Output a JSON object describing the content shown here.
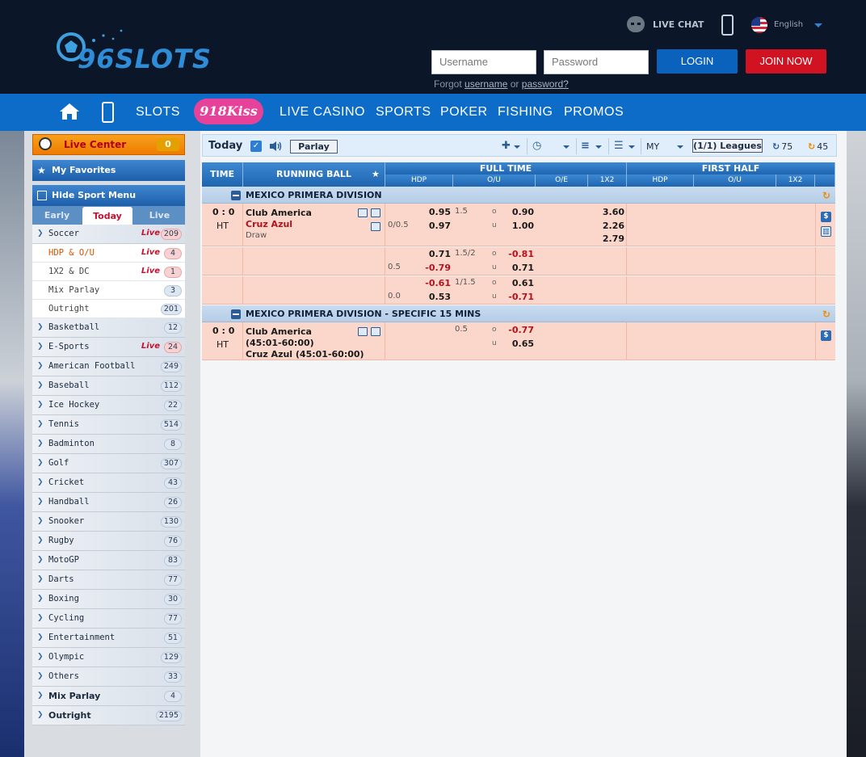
{
  "brand": {
    "logo_text": "96SLOTS"
  },
  "header": {
    "live_chat": "LIVE CHAT",
    "language": "English",
    "username_placeholder": "Username",
    "password_placeholder": "Password",
    "login": "LOGIN",
    "join": "JOIN NOW",
    "forgot_prefix": "Forgot",
    "forgot_username": "username",
    "forgot_or": "or",
    "forgot_password": "password?"
  },
  "nav": {
    "slots": "SLOTS",
    "kiss": "918Kiss",
    "live_casino": "LIVE CASINO",
    "sports": "SPORTS",
    "poker": "POKER",
    "fishing": "FISHING",
    "promos": "PROMOS"
  },
  "sidebar": {
    "live_center": "Live Center",
    "live_center_count": "0",
    "my_favorites": "My Favorites",
    "hide_menu": "Hide Sport Menu",
    "tabs": [
      "Early",
      "Today",
      "Live"
    ],
    "live_label": "Live",
    "sports": [
      {
        "name": "Soccer",
        "live": true,
        "count": "209"
      },
      {
        "name": "HDP & O/U",
        "live": true,
        "count": "4"
      },
      {
        "name": "1X2 & DC",
        "live": true,
        "count": "1"
      },
      {
        "name": "Mix Parlay",
        "count": "3"
      },
      {
        "name": "Outright",
        "count": "201"
      },
      {
        "name": "Basketball",
        "count": "12"
      },
      {
        "name": "E-Sports",
        "live": true,
        "count": "24"
      },
      {
        "name": "American Football",
        "count": "249"
      },
      {
        "name": "Baseball",
        "count": "112"
      },
      {
        "name": "Ice Hockey",
        "count": "22"
      },
      {
        "name": "Tennis",
        "count": "514"
      },
      {
        "name": "Badminton",
        "count": "8"
      },
      {
        "name": "Golf",
        "count": "307"
      },
      {
        "name": "Cricket",
        "count": "43"
      },
      {
        "name": "Handball",
        "count": "26"
      },
      {
        "name": "Snooker",
        "count": "130"
      },
      {
        "name": "Rugby",
        "count": "76"
      },
      {
        "name": "MotoGP",
        "count": "83"
      },
      {
        "name": "Darts",
        "count": "77"
      },
      {
        "name": "Boxing",
        "count": "30"
      },
      {
        "name": "Cycling",
        "count": "77"
      },
      {
        "name": "Entertainment",
        "count": "51"
      },
      {
        "name": "Olympic",
        "count": "129"
      },
      {
        "name": "Others",
        "count": "33"
      },
      {
        "name": "Mix Parlay",
        "count": "4"
      },
      {
        "name": "Outright",
        "count": "2195"
      }
    ]
  },
  "toolbar": {
    "today": "Today",
    "parlay": "Parlay",
    "odds_type": "MY",
    "leagues": "(1/1) Leagues",
    "count_a": "75",
    "count_b": "45"
  },
  "table": {
    "time": "TIME",
    "running_ball": "RUNNING BALL",
    "full_time": "FULL TIME",
    "first_half": "FIRST HALF",
    "hdp": "HDP",
    "ou": "O/U",
    "oe": "O/E",
    "x12": "1X2",
    "o": "o",
    "u": "u",
    "leagues": [
      {
        "name": "MEXICO PRIMERA DIVISION"
      },
      {
        "name": "MEXICO PRIMERA DIVISION - SPECIFIC 15 MINS"
      }
    ],
    "match1": {
      "score": "0 : 0",
      "period": "HT",
      "home": "Club America",
      "away": "Cruz Azul",
      "draw": "Draw",
      "rows": [
        {
          "hdp": "0/0.5",
          "h1": "0.95",
          "h2": "0.97",
          "ou": "1.5",
          "o": "0.90",
          "u": "1.00",
          "x1": "3.60",
          "x2": "2.26",
          "x3": "2.79"
        },
        {
          "hdp": "0.5",
          "h1": "0.71",
          "h2": "-0.79",
          "ou": "1.5/2",
          "o": "-0.81",
          "u": "0.71"
        },
        {
          "hdp": "0.0",
          "h1": "-0.61",
          "h2": "0.53",
          "ou": "1/1.5",
          "o": "0.61",
          "u": "-0.71"
        }
      ]
    },
    "match2": {
      "score": "0 : 0",
      "period": "HT",
      "home": "Club America (45:01-60:00)",
      "away": "Cruz Azul (45:01-60:00)",
      "ou": "0.5",
      "o": "-0.77",
      "u": "0.65"
    }
  }
}
